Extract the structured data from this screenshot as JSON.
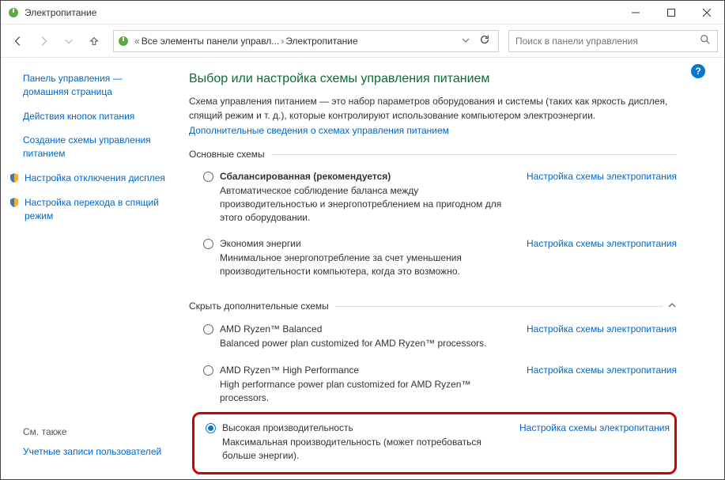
{
  "window": {
    "title": "Электропитание"
  },
  "nav": {
    "breadcrumb_sep1": "«",
    "breadcrumb1": "Все элементы панели управл...",
    "breadcrumb2": "Электропитание",
    "search_placeholder": "Поиск в панели управления"
  },
  "sidebar": {
    "home": "Панель управления — домашняя страница",
    "item1": "Действия кнопок питания",
    "item2": "Создание схемы управления питанием",
    "item3": "Настройка отключения дисплея",
    "item4": "Настройка перехода в спящий режим",
    "see_also": "См. также",
    "accounts": "Учетные записи пользователей"
  },
  "main": {
    "title": "Выбор или настройка схемы управления питанием",
    "desc": "Схема управления питанием — это набор параметров оборудования и системы (таких как яркость дисплея, спящий режим и т. д.), которые контролируют использование компьютером электроэнергии.",
    "more_link": "Дополнительные сведения о схемах управления питанием",
    "section1": "Основные схемы",
    "section2": "Скрыть дополнительные схемы",
    "settings_link": "Настройка схемы электропитания",
    "plans": {
      "balanced": {
        "name": "Сбалансированная (рекомендуется)",
        "desc": "Автоматическое соблюдение баланса между производительностью и энергопотреблением на пригодном для этого оборудовании."
      },
      "saver": {
        "name": "Экономия энергии",
        "desc": "Минимальное энергопотребление за счет уменьшения производительности компьютера, когда это возможно."
      },
      "ryzen_bal": {
        "name": "AMD Ryzen™ Balanced",
        "desc": "Balanced power plan customized for AMD Ryzen™ processors."
      },
      "ryzen_hp": {
        "name": "AMD Ryzen™ High Performance",
        "desc": "High performance power plan customized for AMD Ryzen™ processors."
      },
      "high": {
        "name": "Высокая производительность",
        "desc": "Максимальная производительность (может потребоваться больше энергии)."
      }
    }
  },
  "help": "?"
}
